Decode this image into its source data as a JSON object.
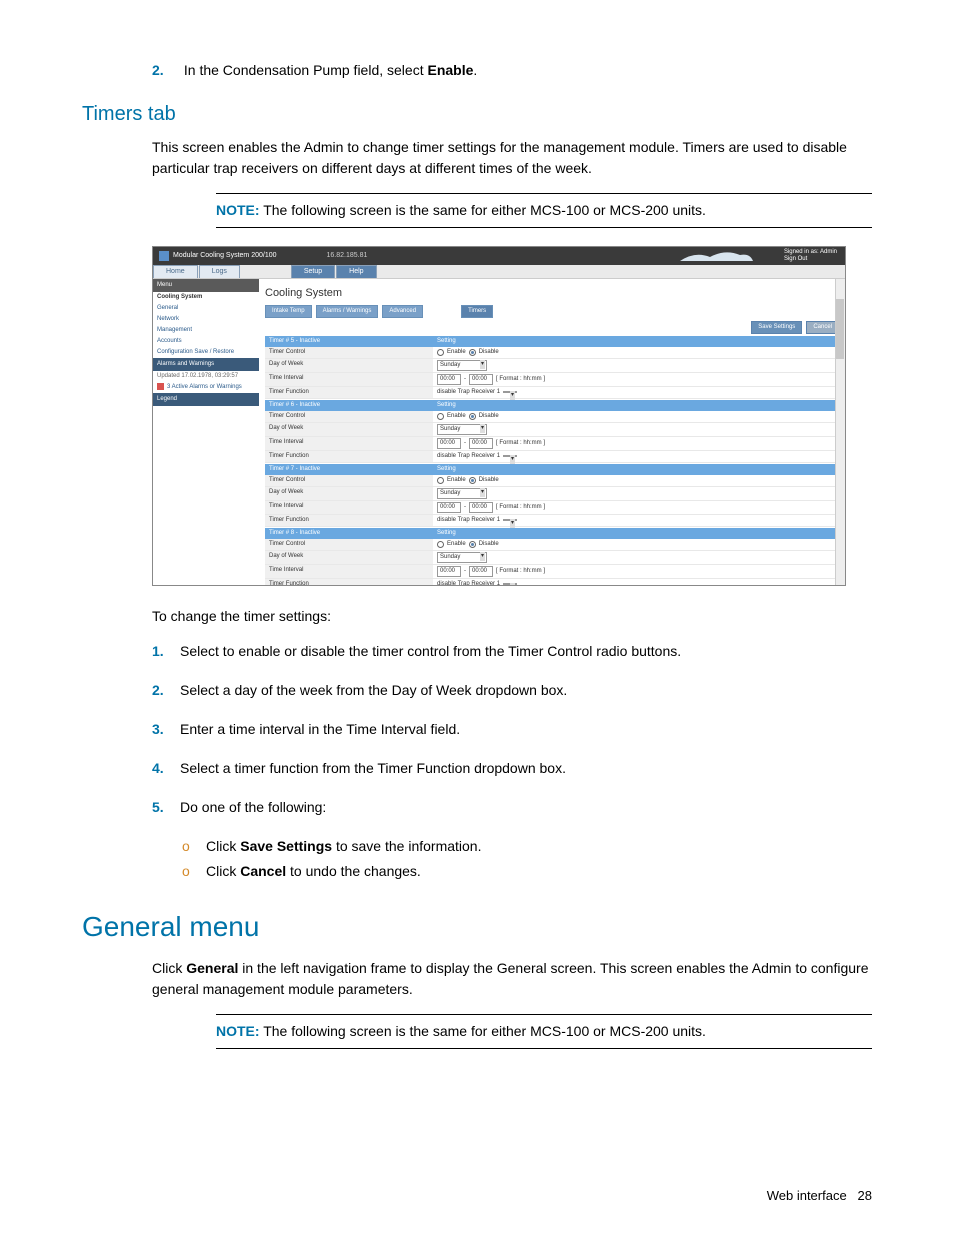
{
  "step_top": {
    "num": "2.",
    "text_before": "In the Condensation Pump field, select ",
    "text_bold": "Enable",
    "text_after": "."
  },
  "timers": {
    "heading": "Timers tab",
    "para": "This screen enables the Admin to change timer settings for the management module. Timers are used to disable particular trap receivers on different days at different times of the week.",
    "note_label": "NOTE:",
    "note_text": "The following screen is the same for either MCS-100 or MCS-200 units."
  },
  "shot": {
    "product": "Modular Cooling System 200/100",
    "ip": "16.82.185.81",
    "signed": "Signed in as: Admin\nSign Out",
    "nav": {
      "home": "Home",
      "logs": "Logs",
      "setup": "Setup",
      "help": "Help"
    },
    "left": {
      "menu": "Menu",
      "cooling_system": "Cooling System",
      "general": "General",
      "network": "Network",
      "management": "Management",
      "accounts": "Accounts",
      "config": "Configuration Save / Restore",
      "alarms_h": "Alarms and Warnings",
      "updated": "Updated 17.02.1978, 03:29:57",
      "alarms_item": "3 Active Alarms or Warnings",
      "legend": "Legend"
    },
    "right_title": "Cooling System",
    "sub_tabs": {
      "intake": "Intake Temp",
      "alarms": "Alarms / Warnings",
      "advanced": "Advanced",
      "timers": "Timers"
    },
    "save": "Save Settings",
    "cancel": "Cancel",
    "fields": {
      "timer_control": "Timer Control",
      "day_of_week": "Day of Week",
      "time_interval": "Time Interval",
      "timer_function": "Timer Function",
      "setting": "Setting",
      "enable": "Enable",
      "disable": "Disable",
      "sunday": "Sunday",
      "t1": "00:00",
      "t2": "00:00",
      "fmt": "[ Format : hh:mm ]",
      "func": "disable Trap Receiver 1"
    },
    "timers_list": [
      "Timer # 5 - Inactive",
      "Timer # 6 - Inactive",
      "Timer # 7 - Inactive",
      "Timer # 8 - Inactive"
    ]
  },
  "change": {
    "intro": "To change the timer settings:",
    "steps": [
      {
        "n": "1.",
        "t": "Select to enable or disable the timer control from the Timer Control radio buttons."
      },
      {
        "n": "2.",
        "t": "Select a day of the week from the Day of Week dropdown box."
      },
      {
        "n": "3.",
        "t": "Enter a time interval in the Time Interval field."
      },
      {
        "n": "4.",
        "t": "Select a timer function from the Timer Function dropdown box."
      },
      {
        "n": "5.",
        "t": "Do one of the following:"
      }
    ],
    "subs": [
      {
        "pre": "Click ",
        "bold": "Save Settings",
        "post": " to save the information."
      },
      {
        "pre": "Click ",
        "bold": "Cancel",
        "post": " to undo the changes."
      }
    ]
  },
  "general": {
    "heading": "General menu",
    "para_pre": "Click ",
    "para_bold": "General",
    "para_post": " in the left navigation frame to display the General screen. This screen enables the Admin to configure general management module parameters.",
    "note_label": "NOTE:",
    "note_text": "The following screen is the same for either MCS-100 or MCS-200 units."
  },
  "footer": {
    "label": "Web interface",
    "page": "28"
  }
}
